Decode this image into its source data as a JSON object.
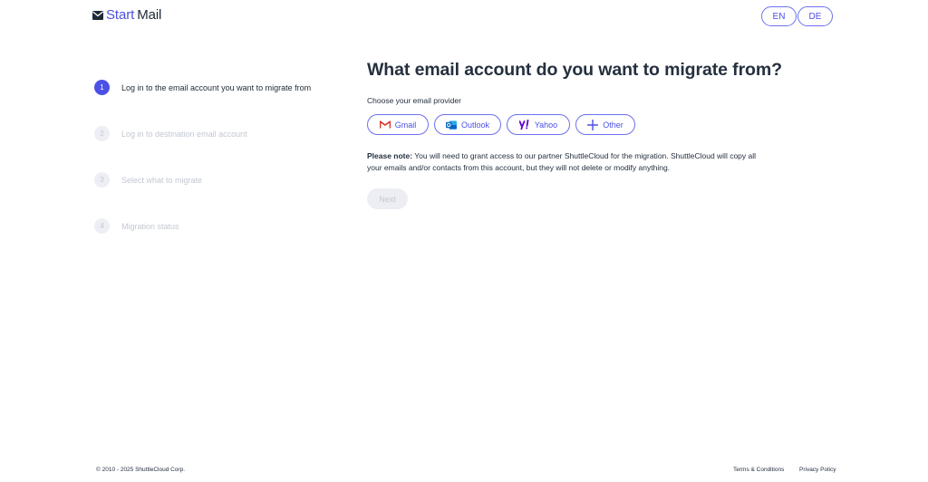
{
  "header": {
    "logo_start": "Start",
    "logo_mail": "Mail",
    "languages": [
      "EN",
      "DE"
    ]
  },
  "steps": [
    {
      "number": "1",
      "label": "Log in to the email account you want to migrate from",
      "state": "active"
    },
    {
      "number": "2",
      "label": "Log in to destination email account",
      "state": "inactive"
    },
    {
      "number": "3",
      "label": "Select what to migrate",
      "state": "inactive"
    },
    {
      "number": "4",
      "label": "Migration status",
      "state": "inactive"
    }
  ],
  "main": {
    "title": "What email account do you want to migrate from?",
    "subtitle": "Choose your email provider",
    "providers": [
      {
        "label": "Gmail",
        "icon": "gmail-icon"
      },
      {
        "label": "Outlook",
        "icon": "outlook-icon"
      },
      {
        "label": "Yahoo",
        "icon": "yahoo-icon"
      },
      {
        "label": "Other",
        "icon": "plus-icon"
      }
    ],
    "note_bold": "Please note:",
    "note_text": " You will need to grant access to our partner ShuttleCloud for the migration. ShuttleCloud will copy all your emails and/or contacts from this account, but they will not delete or modify anything.",
    "next_label": "Next"
  },
  "footer": {
    "copyright": "© 2010 - 2025 ShuttleCloud Corp.",
    "terms": "Terms & Conditions",
    "privacy": "Privacy Policy"
  },
  "colors": {
    "accent": "#4b50e6",
    "text": "#25303f",
    "disabled": "#c3c8d2"
  }
}
